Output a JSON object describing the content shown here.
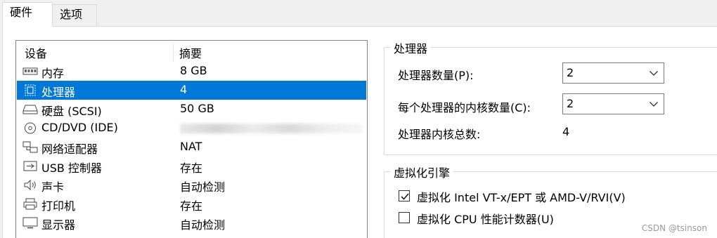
{
  "tabs": [
    {
      "label": "硬件"
    },
    {
      "label": "选项"
    }
  ],
  "devices": {
    "col_device": "设备",
    "col_summary": "摘要",
    "rows": [
      {
        "name": "内存",
        "summary": "8 GB",
        "icon": "memory-icon"
      },
      {
        "name": "处理器",
        "summary": "4",
        "icon": "processor-icon"
      },
      {
        "name": "硬盘 (SCSI)",
        "summary": "50 GB",
        "icon": "hard-disk-icon"
      },
      {
        "name": "CD/DVD (IDE)",
        "summary": "",
        "icon": "cd-dvd-icon"
      },
      {
        "name": "网络适配器",
        "summary": "NAT",
        "icon": "network-adapter-icon"
      },
      {
        "name": "USB 控制器",
        "summary": "存在",
        "icon": "usb-icon"
      },
      {
        "name": "声卡",
        "summary": "自动检测",
        "icon": "speaker-icon"
      },
      {
        "name": "打印机",
        "summary": "存在",
        "icon": "printer-icon"
      },
      {
        "name": "显示器",
        "summary": "自动检测",
        "icon": "monitor-icon"
      }
    ]
  },
  "processor": {
    "group_title": "处理器",
    "count_label": "处理器数量(P):",
    "count_value": "2",
    "cores_label": "每个处理器的内核数量(C):",
    "cores_value": "2",
    "total_label": "处理器内核总数:",
    "total_value": "4"
  },
  "virtualization": {
    "group_title": "虚拟化引擎",
    "vtx_label": "虚拟化 Intel VT-x/EPT 或 AMD-V/RVI(V)",
    "vtx_checked": true,
    "cpu_counters_label": "虚拟化 CPU 性能计数器(U)",
    "cpu_counters_checked": false
  },
  "watermark": "CSDN @tsinson",
  "colors": {
    "selection": "#0078d7",
    "window_bg": "#f0f0f0",
    "pane_bg": "#ffffff"
  }
}
